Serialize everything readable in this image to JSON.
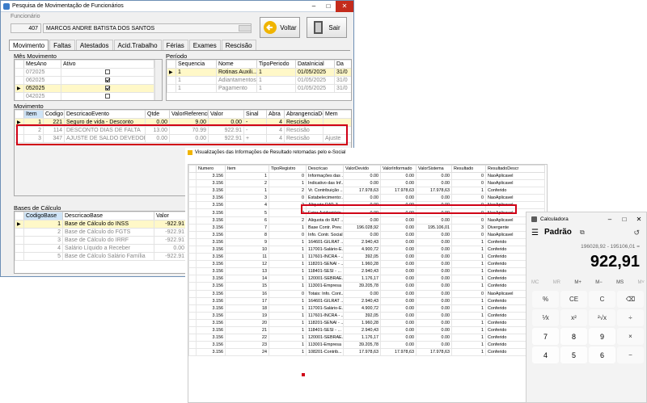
{
  "win1": {
    "title": "Pesquisa de Movimentação de Funcionários",
    "funcionario_label": "Funcionário",
    "emp_id": "407",
    "emp_name": "MARCOS ANDRE BATISTA DOS SANTOS",
    "voltar": "Voltar",
    "sair": "Sair",
    "tabs": [
      "Movimento",
      "Faltas",
      "Atestados",
      "Acid.Trabalho",
      "Férias",
      "Exames",
      "Rescisão"
    ],
    "mes_label": "Mês Movimento",
    "mes_headers": [
      "MesAno",
      "Ativo"
    ],
    "mes_rows": [
      {
        "m": "072025",
        "a": false
      },
      {
        "m": "062025",
        "a": true
      },
      {
        "m": "052025",
        "a": true
      },
      {
        "m": "042025",
        "a": false
      }
    ],
    "per_label": "Período",
    "per_headers": [
      "Sequencia",
      "Nome",
      "TipoPeriodo",
      "DataInicial",
      "Da"
    ],
    "per_rows": [
      [
        "1",
        "Rotinas Auxili...",
        "1",
        "01/05/2025",
        "31/0"
      ],
      [
        "1",
        "Adiantamentos",
        "1",
        "01/05/2025",
        "31/0"
      ],
      [
        "1",
        "Pagamento",
        "1",
        "01/05/2025",
        "31/0"
      ]
    ],
    "mov_label": "Movimento",
    "mov_headers": [
      "Item",
      "Codigo",
      "DescricaoEvento",
      "Qtde",
      "ValorReferenci",
      "Valor",
      "Sinal",
      "Abra",
      "AbrangenciaDe",
      "Mem"
    ],
    "mov_rows": [
      [
        "1",
        "221",
        "Seguro de vida - Desconto",
        "0.00",
        "9.00",
        "0.00",
        "-",
        "4",
        "Rescisão",
        ""
      ],
      [
        "2",
        "114",
        "DESCONTO DIAS DE FALTA",
        "13.00",
        "70.99",
        "922.91",
        "-",
        "4",
        "Rescisão",
        ""
      ],
      [
        "3",
        "347",
        "AJUSTE DE SALDO DEVEDOR",
        "0.00",
        "0.00",
        "922.91",
        "+",
        "4",
        "Rescisão",
        "Ajuste"
      ]
    ],
    "base_label": "Bases de Cálculo",
    "base_headers": [
      "CodigoBase",
      "DescricaoBase",
      "Valor"
    ],
    "base_rows": [
      [
        "1",
        "Base de Cálculo do INSS",
        "-922.91"
      ],
      [
        "2",
        "Base de Cálculo do FGTS",
        "-922.91"
      ],
      [
        "3",
        "Base de Cálculo do IRRF",
        "-922.91"
      ],
      [
        "4",
        "Salário Líquido a Receber",
        "0.00"
      ],
      [
        "5",
        "Base de Cálculo Salário Família",
        "-922.91"
      ]
    ]
  },
  "win2": {
    "title": "Visualizações das Informações de Resultado retornadas pelo e-Social",
    "headers": [
      "Numero",
      "Item",
      "TipoRegistro",
      "Descricao",
      "ValorDevido",
      "ValorInformado",
      "ValorSistema",
      "Resultado",
      "ResultadoDescr"
    ],
    "rows": [
      [
        "3.156",
        "1",
        "0",
        "Informações das ...",
        "0.00",
        "0.00",
        "0.00",
        "0",
        "NaoAplicavel"
      ],
      [
        "3.156",
        "2",
        "1",
        "Indicativo das Inf...",
        "0.00",
        "0.00",
        "0.00",
        "0",
        "NaoAplicavel"
      ],
      [
        "3.156",
        "1",
        "2",
        "Vr. Contribuição ...",
        "17.978,63",
        "17.978,63",
        "17.978,63",
        "1",
        "Conferido"
      ],
      [
        "3.156",
        "3",
        "0",
        "Estabelecimento:...",
        "0.00",
        "0.00",
        "0.00",
        "0",
        "NaoAplicavel"
      ],
      [
        "3.156",
        "4",
        "2",
        "Aliquota RAT: 3",
        "0.00",
        "0.00",
        "0.00",
        "0",
        "NaoAplicavel"
      ],
      [
        "3.156",
        "5",
        "2",
        "Fator Acidentário ...",
        "0.00",
        "0.00",
        "0.00",
        "0",
        "NaoAplicavel"
      ],
      [
        "3.156",
        "6",
        "2",
        "Aliquota do RAT ...",
        "0.00",
        "0.00",
        "0.00",
        "0",
        "NaoAplicavel"
      ],
      [
        "3.156",
        "7",
        "1",
        "Base Contr. Prev. ...",
        "196.028,92",
        "0.00",
        "195.106,01",
        "3",
        "Divergente"
      ],
      [
        "3.156",
        "8",
        "0",
        "Info. Contr. Social...",
        "0.00",
        "0.00",
        "0.00",
        "0",
        "NaoAplicavel"
      ],
      [
        "3.156",
        "9",
        "1",
        "164601-GILRAT ...",
        "2.940,43",
        "0.00",
        "0.00",
        "1",
        "Conferido"
      ],
      [
        "3.156",
        "10",
        "1",
        "117001-Salário-E...",
        "4.900,72",
        "0.00",
        "0.00",
        "1",
        "Conferido"
      ],
      [
        "3.156",
        "11",
        "1",
        "117601-INCRA - ...",
        "392,05",
        "0.00",
        "0.00",
        "1",
        "Conferido"
      ],
      [
        "3.156",
        "12",
        "1",
        "118201-SENAI - ...",
        "1.960,28",
        "0.00",
        "0.00",
        "1",
        "Conferido"
      ],
      [
        "3.156",
        "13",
        "1",
        "118401-SESI - ...",
        "2.940,43",
        "0.00",
        "0.00",
        "1",
        "Conferido"
      ],
      [
        "3.156",
        "14",
        "1",
        "120001-SEBRAE...",
        "1.176,17",
        "0.00",
        "0.00",
        "1",
        "Conferido"
      ],
      [
        "3.156",
        "15",
        "1",
        "113001-Empresa ...",
        "39.205,78",
        "0.00",
        "0.00",
        "1",
        "Conferido"
      ],
      [
        "3.156",
        "16",
        "0",
        "Totais: Info. Cont...",
        "0.00",
        "0.00",
        "0.00",
        "0",
        "NaoAplicavel"
      ],
      [
        "3.156",
        "17",
        "1",
        "164601-GILRAT ...",
        "2.940,43",
        "0.00",
        "0.00",
        "1",
        "Conferido"
      ],
      [
        "3.156",
        "18",
        "1",
        "117001-Salário-E...",
        "4.900,72",
        "0.00",
        "0.00",
        "1",
        "Conferido"
      ],
      [
        "3.156",
        "19",
        "1",
        "117601-INCRA - ...",
        "392,05",
        "0.00",
        "0.00",
        "1",
        "Conferido"
      ],
      [
        "3.156",
        "20",
        "1",
        "118201-SENAI - ...",
        "1.960,28",
        "0.00",
        "0.00",
        "1",
        "Conferido"
      ],
      [
        "3.156",
        "21",
        "1",
        "118401-SESI - ...",
        "2.940,43",
        "0.00",
        "0.00",
        "1",
        "Conferido"
      ],
      [
        "3.156",
        "22",
        "1",
        "120001-SEBRAE...",
        "1.176,17",
        "0.00",
        "0.00",
        "1",
        "Conferido"
      ],
      [
        "3.156",
        "23",
        "1",
        "113001-Empresa ...",
        "39.205,78",
        "0.00",
        "0.00",
        "1",
        "Conferido"
      ],
      [
        "3.156",
        "24",
        "1",
        "108201-Contrib...",
        "17.978,63",
        "17.978,63",
        "17.978,63",
        "1",
        "Conferido"
      ]
    ]
  },
  "calc": {
    "title": "Calculadora",
    "mode": "Padrão",
    "expression": "196028,92 - 195106,01 =",
    "display": "922,91",
    "memory": [
      "MC",
      "MR",
      "M+",
      "M−",
      "MS",
      "M˅"
    ],
    "keys": [
      "%",
      "CE",
      "C",
      "⌫",
      "⅟x",
      "x²",
      "²√x",
      "÷",
      "7",
      "8",
      "9",
      "×",
      "4",
      "5",
      "6",
      "−"
    ]
  }
}
